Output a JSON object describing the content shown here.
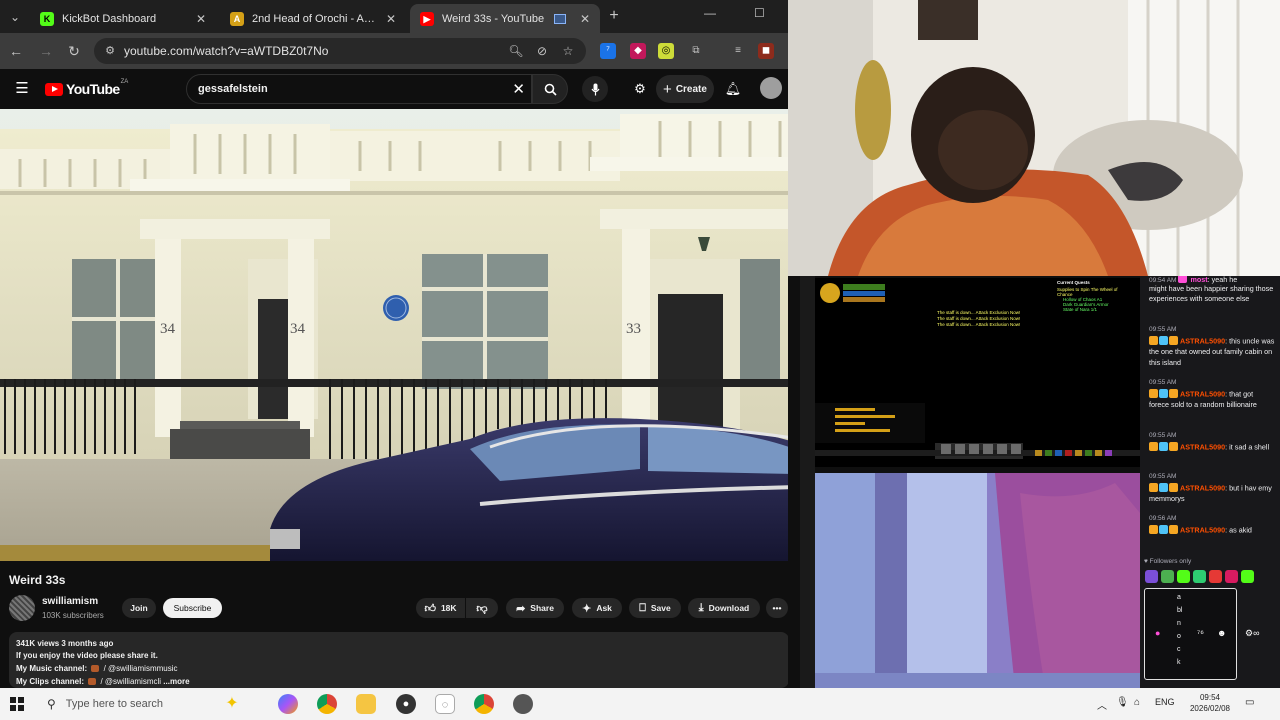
{
  "browser": {
    "tabs": [
      {
        "title": "KickBot Dashboard",
        "active": false,
        "favicon_color": "#53fc18"
      },
      {
        "title": "2nd Head of Orochi - AQW",
        "active": false,
        "favicon_color": "#d4a017"
      },
      {
        "title": "Weird 33s - YouTube",
        "active": true,
        "favicon_color": "#ff0000"
      }
    ],
    "url": "youtube.com/watch?v=aWTDBZ0t7No"
  },
  "youtube": {
    "logo_text": "YouTube",
    "country_code": "ZA",
    "search_query": "gessafelstein",
    "create_label": "Create",
    "video": {
      "title": "Weird 33s",
      "house_numbers": [
        "34",
        "34",
        "33"
      ],
      "channel_name": "swilliamism",
      "subscribers": "103K subscribers",
      "join_label": "Join",
      "subscribe_label": "Subscribe",
      "like_count": "18K",
      "share_label": "Share",
      "ask_label": "Ask",
      "save_label": "Save",
      "download_label": "Download"
    },
    "description": {
      "stats": "341K views  3 months ago",
      "line1": "If you enjoy the video please share it.",
      "music_label": "My Music channel:",
      "music_handle": "/ @swilliamismmusic",
      "clips_label": "My Clips channel:",
      "clips_handle": "/ @swilliamismcli",
      "more_label": "...more"
    }
  },
  "game": {
    "quest_title": "Current Quests",
    "quest_lines": [
      "Supplies to Spin The Wheel of",
      "Chance",
      "Hollow of Chaos A1",
      "Dark Guardian's Armor",
      "State of Nara 1/1"
    ],
    "center_lines": [
      "The staff is down... Attack Exclusion Now!",
      "The staff is down... Attack Exclusion Now!",
      "The staff is down... Attack Exclusion Now!"
    ]
  },
  "chat": {
    "messages": [
      {
        "time": "",
        "user": "",
        "text": "might have been happier sharing those experiences with someone else"
      },
      {
        "time": "09:55 AM",
        "user": "ASTRAL5090",
        "text": "this uncle was the one that owned out family cabin on this island"
      },
      {
        "time": "09:55 AM",
        "user": "ASTRAL5090",
        "text": "that got forece sold to a random billionaire"
      },
      {
        "time": "09:55 AM",
        "user": "ASTRAL5090",
        "text": "it sad a shell"
      },
      {
        "time": "09:55 AM",
        "user": "ASTRAL5090",
        "text": "but i hav emy memmorys"
      },
      {
        "time": "09:56 AM",
        "user": "ASTRAL5090",
        "text": "as akid"
      }
    ],
    "top_partial_time": "09:54 AM",
    "top_partial_user": "most",
    "top_partial_text": "yeah he",
    "followers_only": "Followers only",
    "input_lines": [
      "a",
      "bl",
      "n",
      "o",
      "c",
      "k"
    ]
  },
  "taskbar": {
    "search_placeholder": "Type here to search",
    "language": "ENG",
    "time": "09:54",
    "date": "2026/02/08"
  },
  "colors": {
    "accent_red": "#ff0000",
    "chat_user": "#ff4f00",
    "taskbar": "#f3f3f3"
  }
}
